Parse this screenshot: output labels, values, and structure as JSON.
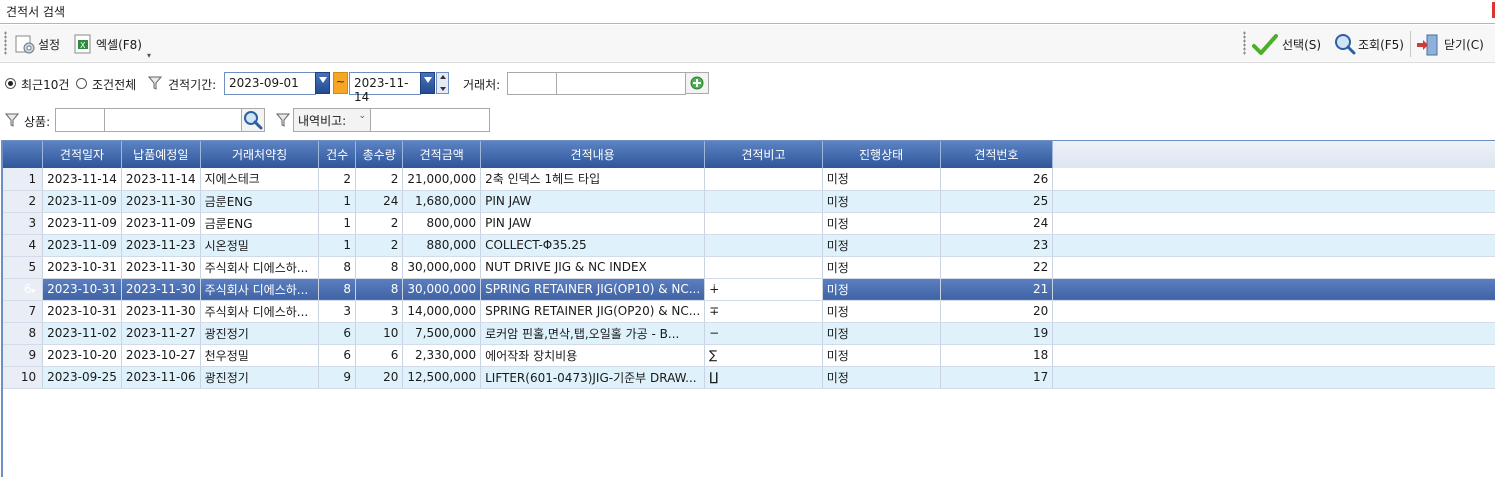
{
  "window": {
    "title": "견적서 검색"
  },
  "toolbar": {
    "settings_label": "설정",
    "excel_label": "엑셀(F8)",
    "select_label": "선택(S)",
    "search_label": "조회(F5)",
    "close_label": "닫기(C)"
  },
  "filters": {
    "recent10_label": "최근10건",
    "all_conditions_label": "조건전체",
    "selected_mode": "최근10건",
    "period_label": "견적기간:",
    "date_from": "2023-09-01",
    "date_to": "2023-11-14",
    "tilde": "~",
    "client_label": "거래처:",
    "client_code": "",
    "client_name": "",
    "product_label": "상품:",
    "product_code": "",
    "product_name": "",
    "detail_remark_select": "내역비고:",
    "detail_remark_value": ""
  },
  "grid": {
    "columns": [
      "",
      "견적일자",
      "납품예정일",
      "거래처약칭",
      "건수",
      "총수량",
      "견적금액",
      "견적내용",
      "견적비고",
      "진행상태",
      "견적번호"
    ],
    "selected_row": 6,
    "rows": [
      {
        "n": "1",
        "date": "2023-11-14",
        "due": "2023-11-14",
        "client": "지에스테크",
        "cnt": "2",
        "qty": "2",
        "amount": "21,000,000",
        "content": "2축 인덱스 1헤드 타입",
        "remark": "",
        "status": "미정",
        "no": "26"
      },
      {
        "n": "2",
        "date": "2023-11-09",
        "due": "2023-11-30",
        "client": "금룬ENG",
        "cnt": "1",
        "qty": "24",
        "amount": "1,680,000",
        "content": "PIN JAW",
        "remark": "",
        "status": "미정",
        "no": "25"
      },
      {
        "n": "3",
        "date": "2023-11-09",
        "due": "2023-11-09",
        "client": "금룬ENG",
        "cnt": "1",
        "qty": "2",
        "amount": "800,000",
        "content": "PIN JAW",
        "remark": "",
        "status": "미정",
        "no": "24"
      },
      {
        "n": "4",
        "date": "2023-11-09",
        "due": "2023-11-23",
        "client": "시온정밀",
        "cnt": "1",
        "qty": "2",
        "amount": "880,000",
        "content": "COLLECT-Φ35.25",
        "remark": "",
        "status": "미정",
        "no": "23"
      },
      {
        "n": "5",
        "date": "2023-10-31",
        "due": "2023-11-30",
        "client": "주식회사 디에스하...",
        "cnt": "8",
        "qty": "8",
        "amount": "30,000,000",
        "content": "NUT DRIVE JIG & NC INDEX",
        "remark": "",
        "status": "미정",
        "no": "22"
      },
      {
        "n": "6",
        "date": "2023-10-31",
        "due": "2023-11-30",
        "client": "주식회사 디에스하...",
        "cnt": "8",
        "qty": "8",
        "amount": "30,000,000",
        "content": "SPRING RETAINER JIG(OP10) & NC...",
        "remark": "∔",
        "status": "미정",
        "no": "21"
      },
      {
        "n": "7",
        "date": "2023-10-31",
        "due": "2023-11-30",
        "client": "주식회사 디에스하...",
        "cnt": "3",
        "qty": "3",
        "amount": "14,000,000",
        "content": "SPRING RETAINER JIG(OP20) & NC...",
        "remark": "∓",
        "status": "미정",
        "no": "20"
      },
      {
        "n": "8",
        "date": "2023-11-02",
        "due": "2023-11-27",
        "client": "광진정기",
        "cnt": "6",
        "qty": "10",
        "amount": "7,500,000",
        "content": "로커암 핀홀,면삭,탭,오일홀 가공 - B...",
        "remark": "−",
        "status": "미정",
        "no": "19"
      },
      {
        "n": "9",
        "date": "2023-10-20",
        "due": "2023-10-27",
        "client": "천우정밀",
        "cnt": "6",
        "qty": "6",
        "amount": "2,330,000",
        "content": "에어작좌 장치비용",
        "remark": "∑",
        "status": "미정",
        "no": "18"
      },
      {
        "n": "10",
        "date": "2023-09-25",
        "due": "2023-11-06",
        "client": "광진정기",
        "cnt": "9",
        "qty": "20",
        "amount": "12,500,000",
        "content": "LIFTER(601-0473)JIG-기준부 DRAW...",
        "remark": "∐",
        "status": "미정",
        "no": "17"
      }
    ]
  }
}
